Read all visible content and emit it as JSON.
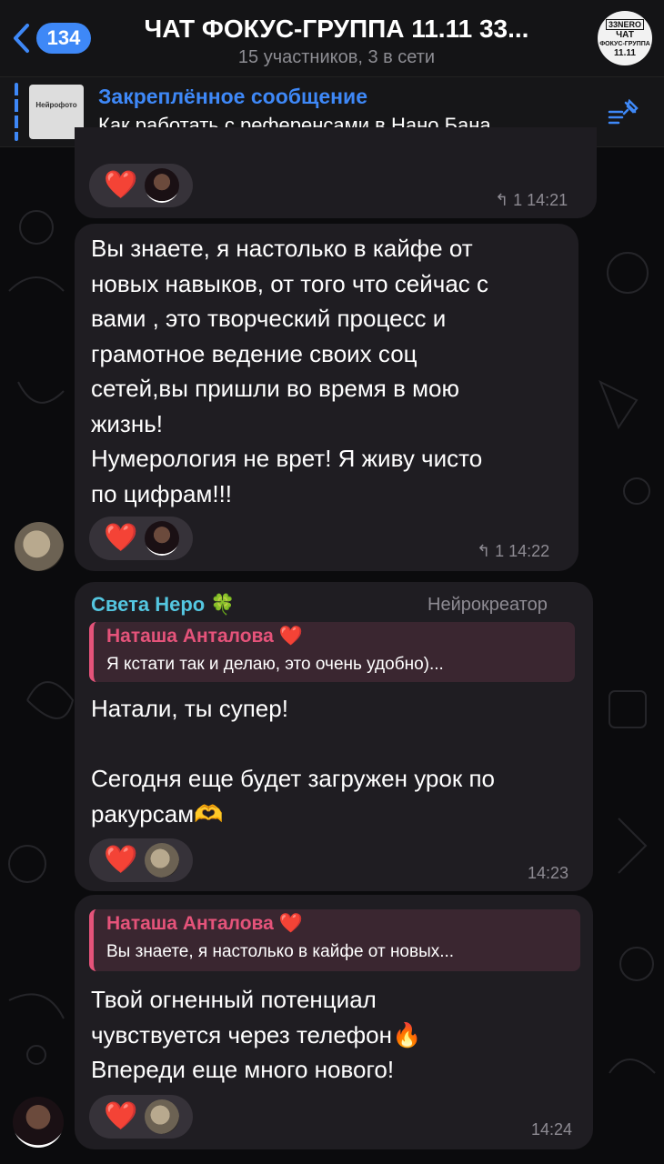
{
  "header": {
    "back_count": "134",
    "title": "ЧАТ ФОКУС-ГРУППА 11.11 33...",
    "subtitle": "15 участников, 3 в сети",
    "avatar_logo": "33NERO",
    "avatar_l1": "ЧАТ",
    "avatar_l2": "ФОКУС-ГРУППА",
    "avatar_l3": "11.11"
  },
  "pinned": {
    "title": "Закреплённое сообщение",
    "text": "Как работать с референсами в Нано Бана...",
    "thumb_title": "Нейрофото"
  },
  "messages": [
    {
      "reactions": "❤️",
      "reply_count": "1",
      "time": "14:21"
    },
    {
      "text": "Вы знаете, я настолько в кайфе от\nновых навыков, от того что сейчас с\nвами , это творческий процесс и\nграмотное ведение своих соц\nсетей,вы пришли во время в мою\nжизнь!\nНумерология не врет! Я живу чисто\nпо цифрам!!!",
      "reactions": "❤️",
      "reply_count": "1",
      "time": "14:22"
    },
    {
      "sender": "Света Неро 🍀",
      "role": "Нейрокреатор",
      "quote_name": "Наташа Анталова ❤️",
      "quote_text": "Я кстати так и делаю, это очень удобно)...",
      "text": "Натали, ты супер!\n\nСегодня еще будет загружен урок по\nракурсам🫶",
      "reactions": "❤️",
      "time": "14:23"
    },
    {
      "quote_name": "Наташа Анталова ❤️",
      "quote_text": "Вы знаете, я настолько в кайфе от новых...",
      "text": "Твой огненный потенциал\nчувствуется через телефон🔥\nВпереди еще много нового!",
      "reactions": "❤️",
      "time": "14:24"
    }
  ],
  "colors": {
    "accent": "#3e88f7",
    "sender": "#54c6e0",
    "quote": "#e5537a",
    "heart": "#f0293e"
  }
}
